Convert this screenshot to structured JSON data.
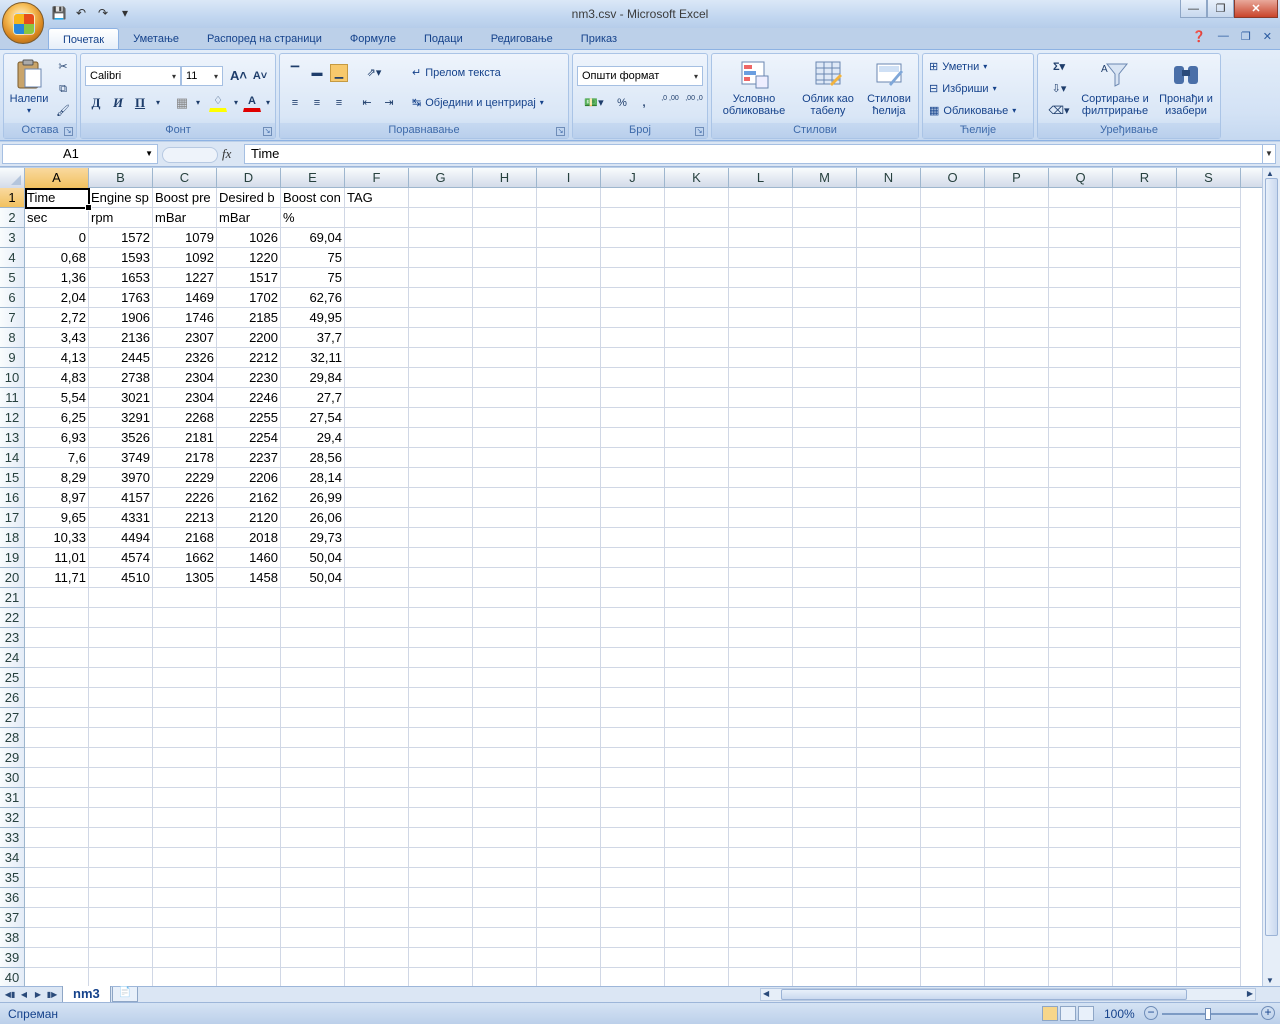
{
  "window": {
    "title": "nm3.csv - Microsoft Excel"
  },
  "tabs": [
    "Почетак",
    "Уметање",
    "Распоред на страници",
    "Формуле",
    "Подаци",
    "Редиговање",
    "Приказ"
  ],
  "ribbon": {
    "clipboard": {
      "paste_label": "Налепи",
      "group_label": "Остава"
    },
    "font": {
      "font_name": "Calibri",
      "font_size": "11",
      "bold": "Д",
      "italic": "И",
      "underline": "П",
      "group_label": "Фонт"
    },
    "alignment": {
      "wrap_text": "Прелом текста",
      "merge_center": "Обједини и центрирај",
      "group_label": "Поравнавање"
    },
    "number": {
      "format": "Општи формат",
      "percent": "%",
      "comma": ",",
      "inc_decimal": ",0 ,00",
      "dec_decimal": ",00 ,0",
      "group_label": "Број"
    },
    "styles": {
      "conditional": "Условно обликовање",
      "as_table": "Облик кao табелу",
      "cell_styles": "Стилови ћелија",
      "group_label": "Стилови"
    },
    "cells": {
      "insert": "Уметни",
      "delete": "Избриши",
      "format": "Обликовање",
      "group_label": "Ћелије"
    },
    "editing": {
      "sort_filter": "Сортирање и филтрирање",
      "find_select": "Пронађи и изабери",
      "group_label": "Уређивање"
    }
  },
  "formula_bar": {
    "name_box": "A1",
    "fx": "fx",
    "content": "Time"
  },
  "columns": [
    "A",
    "B",
    "C",
    "D",
    "E",
    "F",
    "G",
    "H",
    "I",
    "J",
    "K",
    "L",
    "M",
    "N",
    "O",
    "P",
    "Q",
    "R",
    "S"
  ],
  "rows": [
    [
      "Time",
      "Engine sp",
      "Boost pre",
      "Desired b",
      "Boost con",
      "TAG"
    ],
    [
      "sec",
      "rpm",
      "mBar",
      "mBar",
      "%",
      ""
    ],
    [
      "0",
      "1572",
      "1079",
      "1026",
      "69,04",
      ""
    ],
    [
      "0,68",
      "1593",
      "1092",
      "1220",
      "75",
      ""
    ],
    [
      "1,36",
      "1653",
      "1227",
      "1517",
      "75",
      ""
    ],
    [
      "2,04",
      "1763",
      "1469",
      "1702",
      "62,76",
      ""
    ],
    [
      "2,72",
      "1906",
      "1746",
      "2185",
      "49,95",
      ""
    ],
    [
      "3,43",
      "2136",
      "2307",
      "2200",
      "37,7",
      ""
    ],
    [
      "4,13",
      "2445",
      "2326",
      "2212",
      "32,11",
      ""
    ],
    [
      "4,83",
      "2738",
      "2304",
      "2230",
      "29,84",
      ""
    ],
    [
      "5,54",
      "3021",
      "2304",
      "2246",
      "27,7",
      ""
    ],
    [
      "6,25",
      "3291",
      "2268",
      "2255",
      "27,54",
      ""
    ],
    [
      "6,93",
      "3526",
      "2181",
      "2254",
      "29,4",
      ""
    ],
    [
      "7,6",
      "3749",
      "2178",
      "2237",
      "28,56",
      ""
    ],
    [
      "8,29",
      "3970",
      "2229",
      "2206",
      "28,14",
      ""
    ],
    [
      "8,97",
      "4157",
      "2226",
      "2162",
      "26,99",
      ""
    ],
    [
      "9,65",
      "4331",
      "2213",
      "2120",
      "26,06",
      ""
    ],
    [
      "10,33",
      "4494",
      "2168",
      "2018",
      "29,73",
      ""
    ],
    [
      "11,01",
      "4574",
      "1662",
      "1460",
      "50,04",
      ""
    ],
    [
      "11,71",
      "4510",
      "1305",
      "1458",
      "50,04",
      ""
    ]
  ],
  "row_count": 40,
  "sheet_tab": "nm3",
  "status": {
    "text": "Спреман",
    "zoom": "100%"
  }
}
